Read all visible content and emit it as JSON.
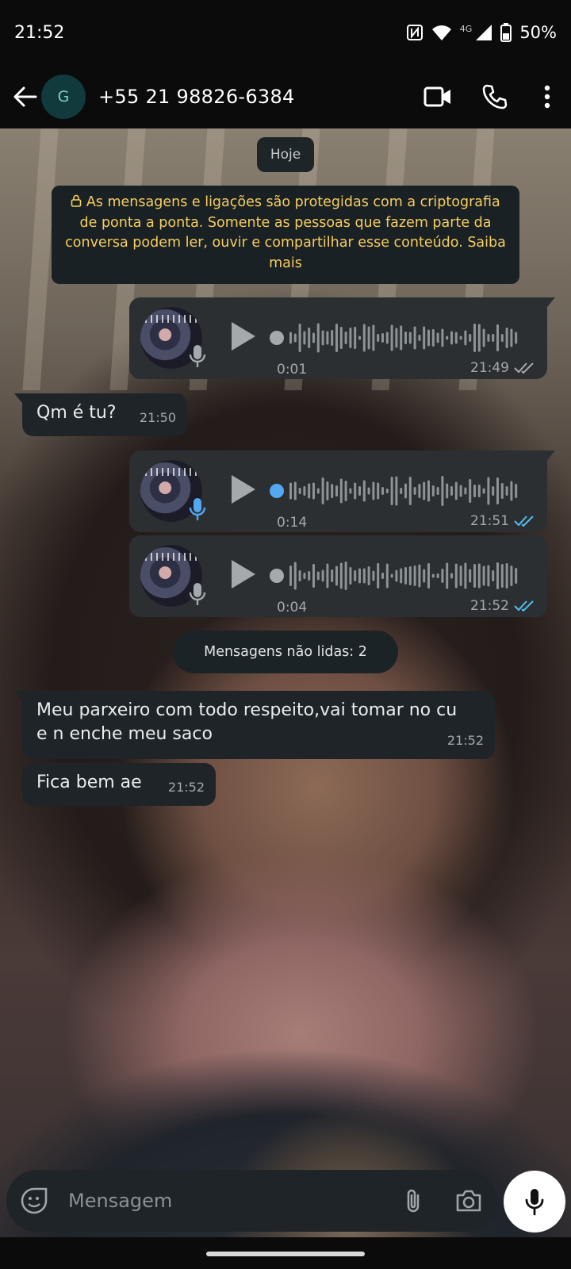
{
  "status_bar": {
    "time": "21:52",
    "network": "4G",
    "battery": "50%"
  },
  "header": {
    "avatar_letter": "G",
    "contact_name": "+55 21 98826-6384",
    "icons": [
      "back-arrow-icon",
      "video-call-icon",
      "voice-call-icon",
      "more-options-icon"
    ]
  },
  "chat": {
    "date_label": "Hoje",
    "encryption_notice": "As mensagens e ligações são protegidas com a criptografia de ponta a ponta. Somente as pessoas que fazem parte da conversa podem ler, ouvir e compartilhar esse conteúdo. Saiba mais",
    "messages": [
      {
        "type": "voice",
        "direction": "out",
        "duration": "0:01",
        "time": "21:49",
        "read": false,
        "progress": 0
      },
      {
        "type": "text",
        "direction": "in",
        "text": "Qm é tu?",
        "time": "21:50"
      },
      {
        "type": "voice",
        "direction": "out",
        "duration": "0:14",
        "time": "21:51",
        "read": true,
        "progress": 0
      },
      {
        "type": "voice",
        "direction": "out",
        "duration": "0:04",
        "time": "21:52",
        "read": true,
        "progress": 0
      }
    ],
    "unread_label": "Mensagens não lidas: 2",
    "unread_messages": [
      {
        "type": "text",
        "direction": "in",
        "text": "Meu parxeiro com todo respeito,vai tomar no cu e n enche meu saco",
        "time": "21:52"
      },
      {
        "type": "text",
        "direction": "in",
        "text": "Fica bem ae",
        "time": "21:52"
      }
    ]
  },
  "composer": {
    "placeholder": "Mensagem"
  },
  "colors": {
    "incoming_bubble": "#1e2428",
    "outgoing_bubble": "#2b2f31",
    "notice_text": "#f7cd5f",
    "read_tick": "#53bdeb",
    "unplayed_dot": "#53a8f0"
  }
}
